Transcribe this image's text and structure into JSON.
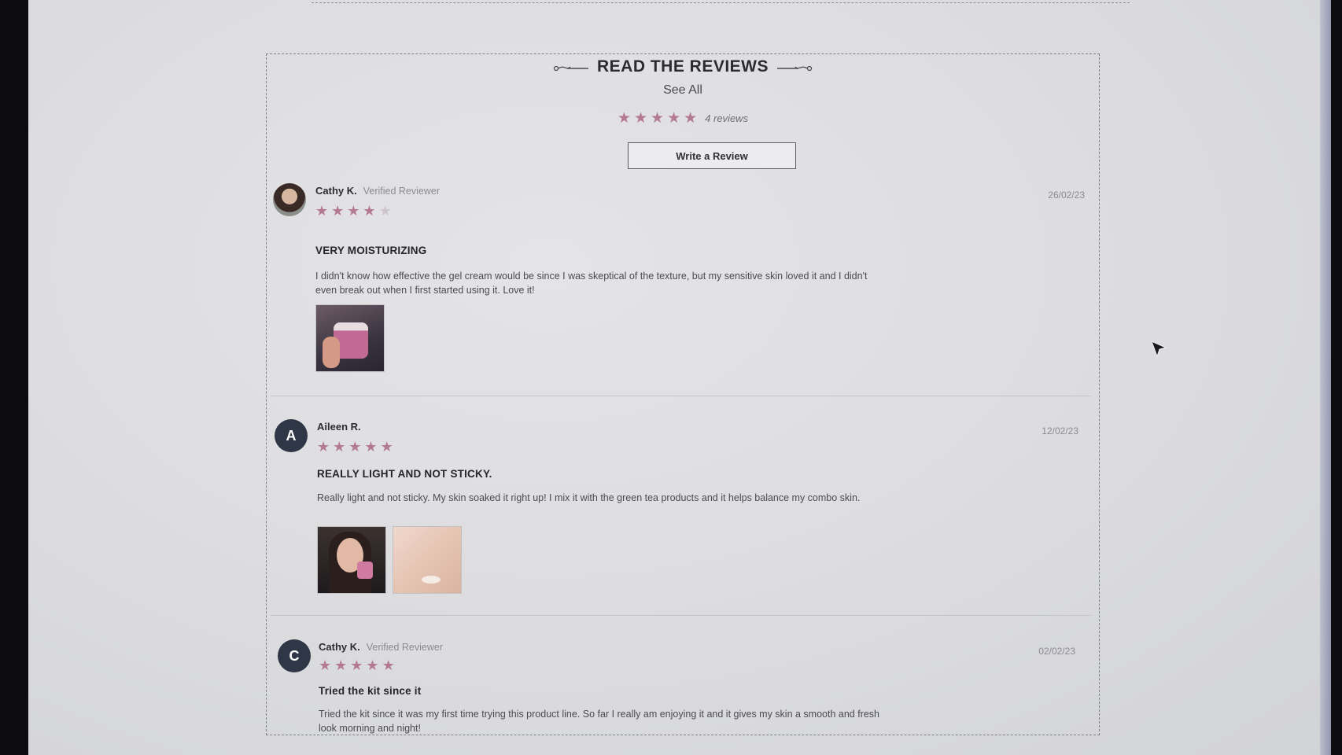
{
  "header": {
    "title": "READ THE REVIEWS",
    "see_all": "See All",
    "rating": 5,
    "review_count": "4 reviews",
    "write_button": "Write a Review"
  },
  "reviews": [
    {
      "author": "Cathy K.",
      "verified": "Verified Reviewer",
      "date": "26/02/23",
      "rating": 4,
      "title": "VERY MOISTURIZING",
      "body": "I didn't know how effective the gel cream would be since I was skeptical of the texture, but my sensitive skin loved it and I didn't even break out when I first started using it. Love it!",
      "avatar": "photo"
    },
    {
      "author": "Aileen R.",
      "verified": "",
      "date": "12/02/23",
      "rating": 5,
      "title": "REALLY LIGHT AND NOT STICKY.",
      "body": "Really light and not sticky. My skin soaked it right up! I mix it with the green tea products and it helps balance my combo skin.",
      "avatar": "A"
    },
    {
      "author": "Cathy K.",
      "verified": "Verified Reviewer",
      "date": "02/02/23",
      "rating": 5,
      "title": "Tried the kit since it",
      "body": "Tried the kit since it was my first time trying this product line. So far I really am enjoying it and it gives my skin a smooth and fresh look morning and night!",
      "avatar": "C"
    }
  ],
  "colors": {
    "star": "#b37a92",
    "avatar_bg": "#2f3646"
  }
}
